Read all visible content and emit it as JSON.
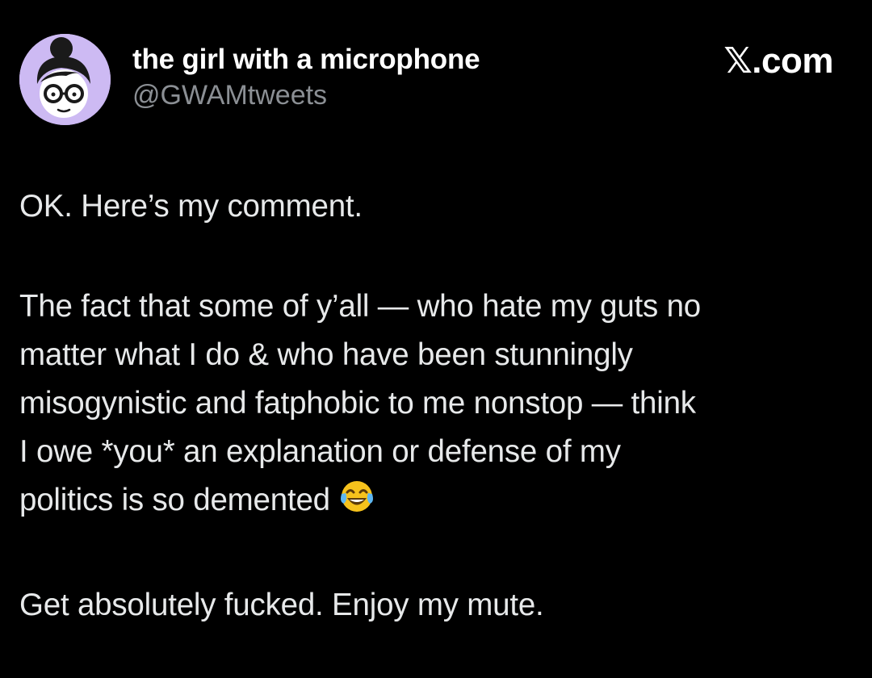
{
  "author": {
    "display_name": "the girl with a microphone",
    "handle": "@GWAMtweets",
    "avatar_icon": "cartoon-woman-glasses-avatar"
  },
  "brand": {
    "label": "𝕏.com"
  },
  "tweet": {
    "line_1": "OK. Here’s my comment.",
    "paragraph_2_lines": [
      "The fact that some of y’all — who hate my guts no",
      "matter what I do & who have been stunningly",
      "misogynistic and fatphobic to me nonstop — think",
      "I owe *you* an explanation or defense of my",
      "politics is so demented"
    ],
    "emoji": "face-with-tears-of-joy-icon",
    "line_last": "Get absolutely fucked. Enjoy my mute."
  },
  "colors": {
    "background": "#000000",
    "text": "#e7e9ea",
    "secondary_text": "#8b8f94",
    "avatar_bg": "#c9b6f0"
  }
}
